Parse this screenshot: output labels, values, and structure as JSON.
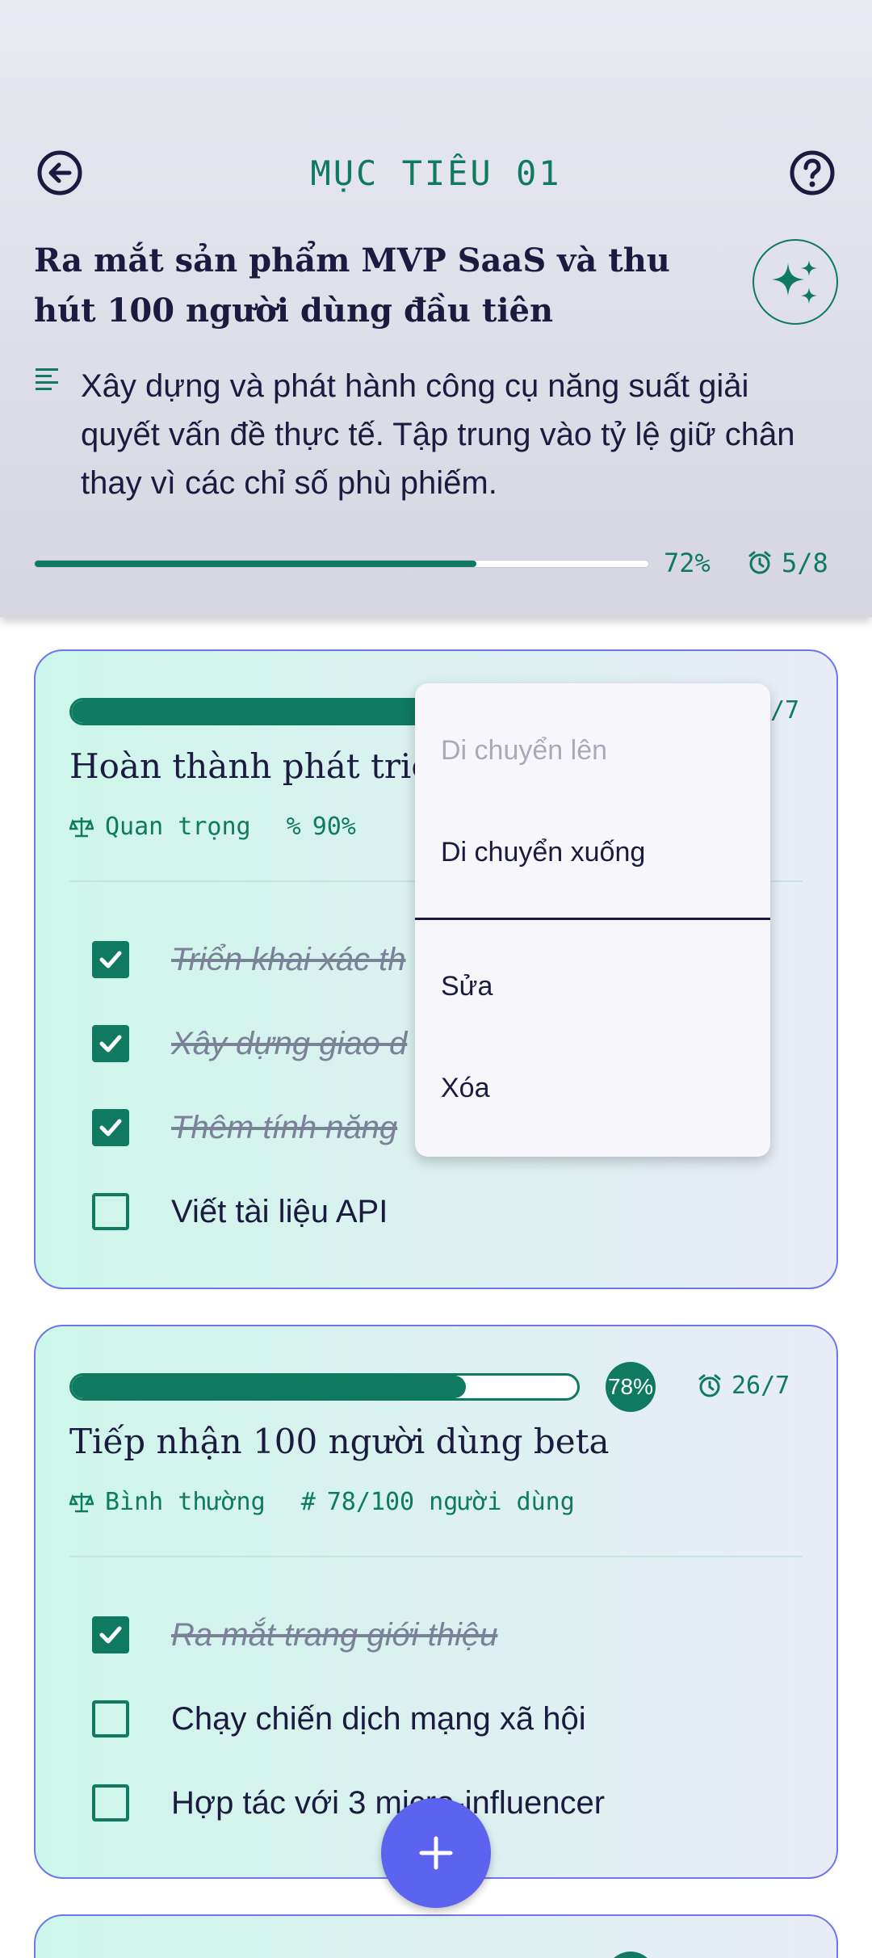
{
  "header": {
    "goal_label": "MỤC TIÊU 01",
    "goal_name": "Ra mắt sản phẩm MVP SaaS và thu hút 100 người dùng đầu tiên",
    "description": "Xây dựng và phát hành công cụ năng suất giải quyết vấn đề thực tế. Tập trung vào tỷ lệ giữ chân thay vì các chỉ số phù phiếm.",
    "progress_fraction": 0.72,
    "progress_label": "72%",
    "tasks_label": "5/8"
  },
  "cards": [
    {
      "progress_fraction": 0.78,
      "date_label": "/7",
      "title": "Hoàn thành phát triển",
      "priority": "Quan trọng",
      "metric": "90%",
      "tasks": [
        {
          "label": "Triển khai xác th",
          "done": true
        },
        {
          "label": "Xây dựng giao d",
          "done": true
        },
        {
          "label": "Thêm tính năng",
          "done": true
        },
        {
          "label": "Viết tài liệu API",
          "done": false
        }
      ]
    },
    {
      "progress_fraction": 0.78,
      "percent_label": "78%",
      "date_label": "26/7",
      "title": "Tiếp nhận 100 người dùng beta",
      "priority": "Bình thường",
      "metric": "78/100 người dùng",
      "tasks": [
        {
          "label": "Ra mắt trang giới thiệu",
          "done": true
        },
        {
          "label": "Chạy chiến dịch mạng xã hội",
          "done": false
        },
        {
          "label": "Hợp tác với 3 micro-influencer",
          "done": false
        }
      ]
    }
  ],
  "menu": {
    "move_up": "Di chuyển lên",
    "move_down": "Di chuyển xuống",
    "edit": "Sửa",
    "delete": "Xóa"
  },
  "colors": {
    "accent": "#0f7a60",
    "fab": "#5c63ee",
    "ink": "#1b1a3f"
  },
  "icons": {
    "back": "arrow-left-circle-icon",
    "help": "help-circle-icon",
    "ai": "sparkle-icon",
    "description": "notes-icon",
    "deadline": "alarm-icon",
    "priority": "scale-icon",
    "fab": "plus-icon"
  }
}
